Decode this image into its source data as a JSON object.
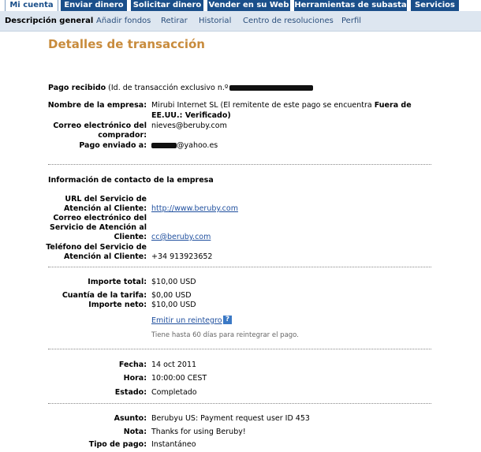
{
  "tabs": [
    "Mi cuenta",
    "Enviar dinero",
    "Solicitar dinero",
    "Vender en su Web",
    "Herramientas de subasta",
    "Servicios"
  ],
  "subnav": [
    "Descripción general",
    "Añadir fondos",
    "Retirar",
    "Historial",
    "Centro de resoluciones",
    "Perfil"
  ],
  "page_title": "Detalles de transacción",
  "payment": {
    "heading_bold": "Pago recibido",
    "heading_normal": " (Id. de transacción exclusivo n.º",
    "company_label": "Nombre de la empresa:",
    "company_value_line1_a": "Mirubi Internet SL (El remitente de este pago se encuentra ",
    "company_value_line1_b": "Fuera de",
    "company_value_line2": "EE.UU.: Verificado)",
    "buyer_email_label_1": "Correo electrónico del",
    "buyer_email_label_2": "comprador:",
    "buyer_email_value": "nieves@beruby.com",
    "sent_to_label": "Pago enviado a:",
    "sent_to_value": "@yahoo.es"
  },
  "contact": {
    "heading": "Información de contacto de la empresa",
    "url_label_1": "URL del Servicio de",
    "url_label_2": "Atención al Cliente:",
    "url_value": "http://www.beruby.com",
    "email_label_1": "Correo electrónico del",
    "email_label_2": "Servicio de Atención al",
    "email_label_3": "Cliente:",
    "email_value": "cc@beruby.com",
    "phone_label_1": "Teléfono del Servicio de",
    "phone_label_2": "Atención al Cliente:",
    "phone_value": "+34 913923652"
  },
  "amounts": {
    "total_label": "Importe total:",
    "total_value": "$10,00 USD",
    "fee_label": "Cuantía de la tarifa:",
    "fee_value": "$0,00 USD",
    "net_label": "Importe neto:",
    "net_value": "$10,00 USD",
    "refund_link": "Emitir un reintegro",
    "help_icon": "?",
    "refund_note": "Tiene hasta 60 días para reintegrar el pago."
  },
  "status": {
    "date_label": "Fecha:",
    "date_value": "14 oct 2011",
    "time_label": "Hora:",
    "time_value": "10:00:00 CEST",
    "state_label": "Estado:",
    "state_value": "Completado"
  },
  "details": {
    "subject_label": "Asunto:",
    "subject_value": "Berubyu US: Payment request user ID 453",
    "note_label": "Nota:",
    "note_value": "Thanks for using Beruby!",
    "type_label": "Tipo de pago:",
    "type_value": "Instantáneo"
  },
  "colors": {
    "tab_bg": "#1a4f8a",
    "title": "#c88b3c",
    "link": "#1f4f9e",
    "subnav_bg": "#dde6f0"
  }
}
